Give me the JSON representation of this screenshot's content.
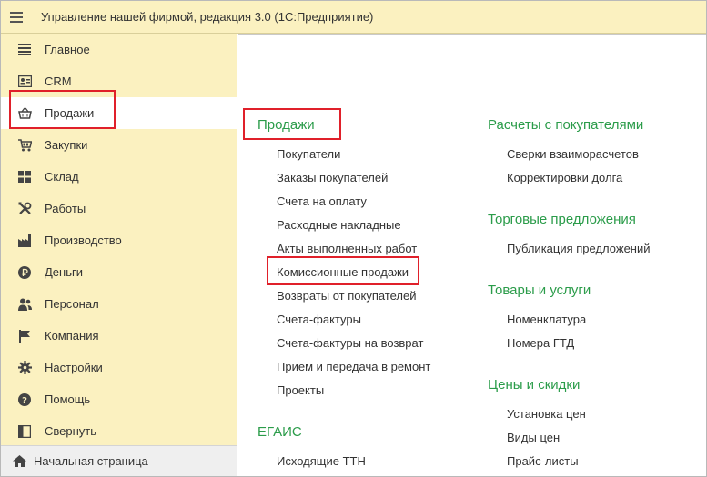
{
  "window": {
    "title": "Управление нашей фирмой, редакция 3.0  (1С:Предприятие)",
    "menu_icon": "hamburger-icon"
  },
  "sidebar": {
    "items": [
      {
        "label": "Главное",
        "icon": "list-icon"
      },
      {
        "label": "CRM",
        "icon": "contact-card-icon"
      },
      {
        "label": "Продажи",
        "icon": "basket-icon",
        "active": true
      },
      {
        "label": "Закупки",
        "icon": "cart-icon"
      },
      {
        "label": "Склад",
        "icon": "warehouse-grid-icon"
      },
      {
        "label": "Работы",
        "icon": "tools-icon"
      },
      {
        "label": "Производство",
        "icon": "factory-icon"
      },
      {
        "label": "Деньги",
        "icon": "ruble-coin-icon"
      },
      {
        "label": "Персонал",
        "icon": "people-icon"
      },
      {
        "label": "Компания",
        "icon": "flag-icon"
      },
      {
        "label": "Настройки",
        "icon": "gear-icon"
      },
      {
        "label": "Помощь",
        "icon": "help-icon"
      },
      {
        "label": "Свернуть",
        "icon": "collapse-icon"
      }
    ],
    "home": {
      "label": "Начальная страница",
      "icon": "home-icon"
    }
  },
  "sections": {
    "sales": {
      "title": "Продажи",
      "links": [
        "Покупатели",
        "Заказы покупателей",
        "Счета на оплату",
        "Расходные накладные",
        "Акты выполненных работ",
        "Комиссионные продажи",
        "Возвраты от покупателей",
        "Счета-фактуры",
        "Счета-фактуры на возврат",
        "Прием и передача в ремонт",
        "Проекты"
      ]
    },
    "egais": {
      "title": "ЕГАИС",
      "links": [
        "Исходящие ТТН"
      ]
    },
    "settlements": {
      "title": "Расчеты с покупателями",
      "links": [
        "Сверки взаиморасчетов",
        "Корректировки долга"
      ]
    },
    "offers": {
      "title": "Торговые предложения",
      "links": [
        "Публикация предложений"
      ]
    },
    "goods": {
      "title": "Товары и услуги",
      "links": [
        "Номенклатура",
        "Номера ГТД"
      ]
    },
    "prices": {
      "title": "Цены и скидки",
      "links": [
        "Установка цен",
        "Виды цен",
        "Прайс-листы"
      ]
    }
  },
  "colors": {
    "accent_green": "#2b9c4a",
    "sidebar_bg": "#fbf1c0",
    "highlight_red": "#e0202a"
  }
}
